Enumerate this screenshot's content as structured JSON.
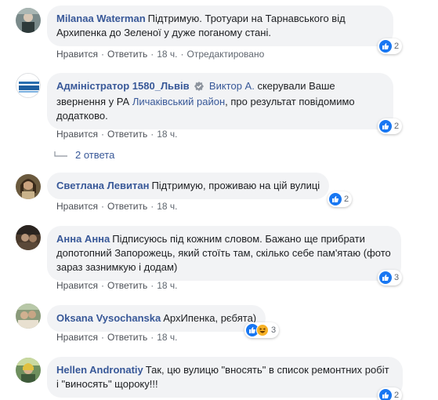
{
  "actions": {
    "like": "Нравится",
    "reply": "Ответить",
    "sep": "·"
  },
  "comments": [
    {
      "author": "Milanaa Waterman",
      "text": "Підтримую. Тротуари на Тарнавського від Архипенка до Зеленої у дуже поганому стані.",
      "time": "18 ч.",
      "edited": "Отредактировано",
      "reactions": "2"
    },
    {
      "author": "Адміністратор 1580_Львів",
      "avatar_text": "Адміністратор 1580_Львів",
      "mention": "Виктор А.",
      "text_1": "скерували Ваше звернення у РА",
      "link": "Личаківський район",
      "text_2": ", про результат повідомимо додатково.",
      "time": "18 ч.",
      "reactions": "2",
      "replies": "2 ответа"
    },
    {
      "author": "Светлана Левитан",
      "text": "Підтримую, проживаю на цій вулиці",
      "time": "18 ч.",
      "reactions": "2"
    },
    {
      "author": "Анна Анна",
      "text": "Підписуюсь під кожним словом. Бажано ще прибрати допотопний Запорожець, який стоїть там, скілько себе пам'ятаю (фото зараз зазнимкую і додам)",
      "time": "18 ч.",
      "reactions": "3"
    },
    {
      "author": "Oksana Vysochanska",
      "text": "АрхИпенка, рєбята)",
      "time": "18 ч.",
      "reactions": "3"
    },
    {
      "author": "Hellen Andronatiy",
      "text": "Так, цю вулицю \"вносять\" в список ремонтних робіт і \"виносять\" щороку!!!",
      "reactions": "2"
    }
  ],
  "colors": {
    "link": "#385898",
    "bubble": "#f2f3f5",
    "like": "#1877f2"
  }
}
